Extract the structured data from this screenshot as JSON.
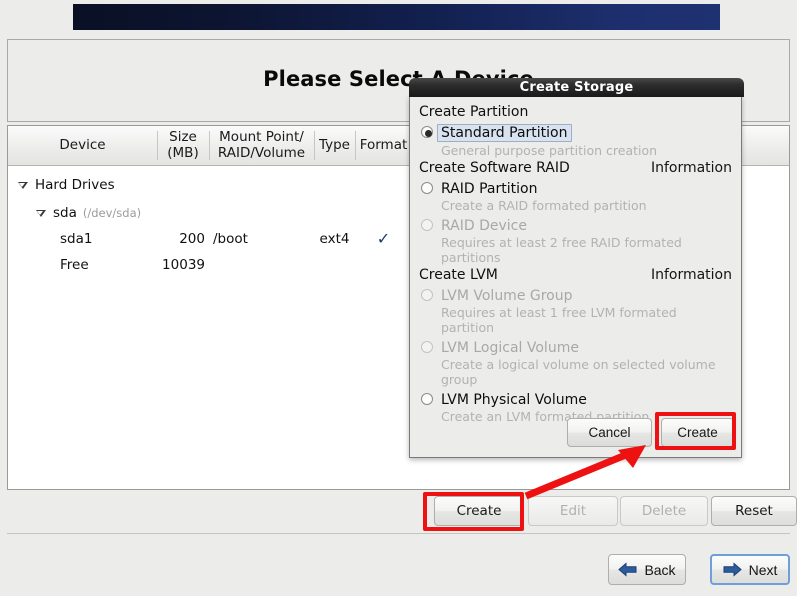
{
  "window": {
    "title": "Please Select A Device"
  },
  "device_table": {
    "headers": [
      "Device",
      "Size\n(MB)",
      "Mount Point/\nRAID/Volume",
      "Type",
      "Format",
      ""
    ],
    "header_device": "Device",
    "header_size_line1": "Size",
    "header_size_line2": "(MB)",
    "header_mount_line1": "Mount Point/",
    "header_mount_line2": "RAID/Volume",
    "header_type": "Type",
    "header_format": "Format",
    "rows": [
      {
        "device": "Hard Drives",
        "size": "",
        "mount": "",
        "type": "",
        "format": "",
        "indent": "group",
        "expanded": true
      },
      {
        "device": "sda",
        "devpath": "(/dev/sda)",
        "size": "",
        "mount": "",
        "type": "",
        "format": "",
        "indent": "disk",
        "expanded": true
      },
      {
        "device": "sda1",
        "size": "200",
        "mount": "/boot",
        "type": "ext4",
        "format": "✓",
        "indent": "part"
      },
      {
        "device": "Free",
        "size": "10039",
        "mount": "",
        "type": "",
        "format": "",
        "indent": "part"
      }
    ]
  },
  "action_buttons": {
    "create": "Create",
    "edit": "Edit",
    "delete": "Delete",
    "reset": "Reset"
  },
  "nav_buttons": {
    "back": "Back",
    "next": "Next"
  },
  "dialog": {
    "title": "Create Storage",
    "sections": [
      {
        "heading": "Create Partition",
        "information": "",
        "options": [
          {
            "label": "Standard Partition",
            "description": "General purpose partition creation",
            "selected": true,
            "enabled": true,
            "focused": true
          }
        ]
      },
      {
        "heading": "Create Software RAID",
        "information": "Information",
        "options": [
          {
            "label": "RAID Partition",
            "description": "Create a RAID formated partition",
            "selected": false,
            "enabled": true,
            "focused": false
          },
          {
            "label": "RAID Device",
            "description": "Requires at least 2 free RAID formated partitions",
            "selected": false,
            "enabled": false,
            "focused": false
          }
        ]
      },
      {
        "heading": "Create LVM",
        "information": "Information",
        "options": [
          {
            "label": "LVM Volume Group",
            "description": "Requires at least 1 free LVM formated partition",
            "selected": false,
            "enabled": false,
            "focused": false
          },
          {
            "label": "LVM Logical Volume",
            "description": "Create a logical volume on selected volume group",
            "selected": false,
            "enabled": false,
            "focused": false
          },
          {
            "label": "LVM Physical Volume",
            "description": "Create an LVM formated partition",
            "selected": false,
            "enabled": true,
            "focused": false
          }
        ]
      }
    ],
    "buttons": {
      "cancel": "Cancel",
      "create": "Create"
    }
  },
  "annotations": {
    "highlight_color": "#ee1111",
    "highlighted_elements": [
      "dialog-create-button",
      "bottom-create-button"
    ],
    "arrow": {
      "from": "bottom-create-button",
      "to": "dialog-create-button"
    }
  }
}
